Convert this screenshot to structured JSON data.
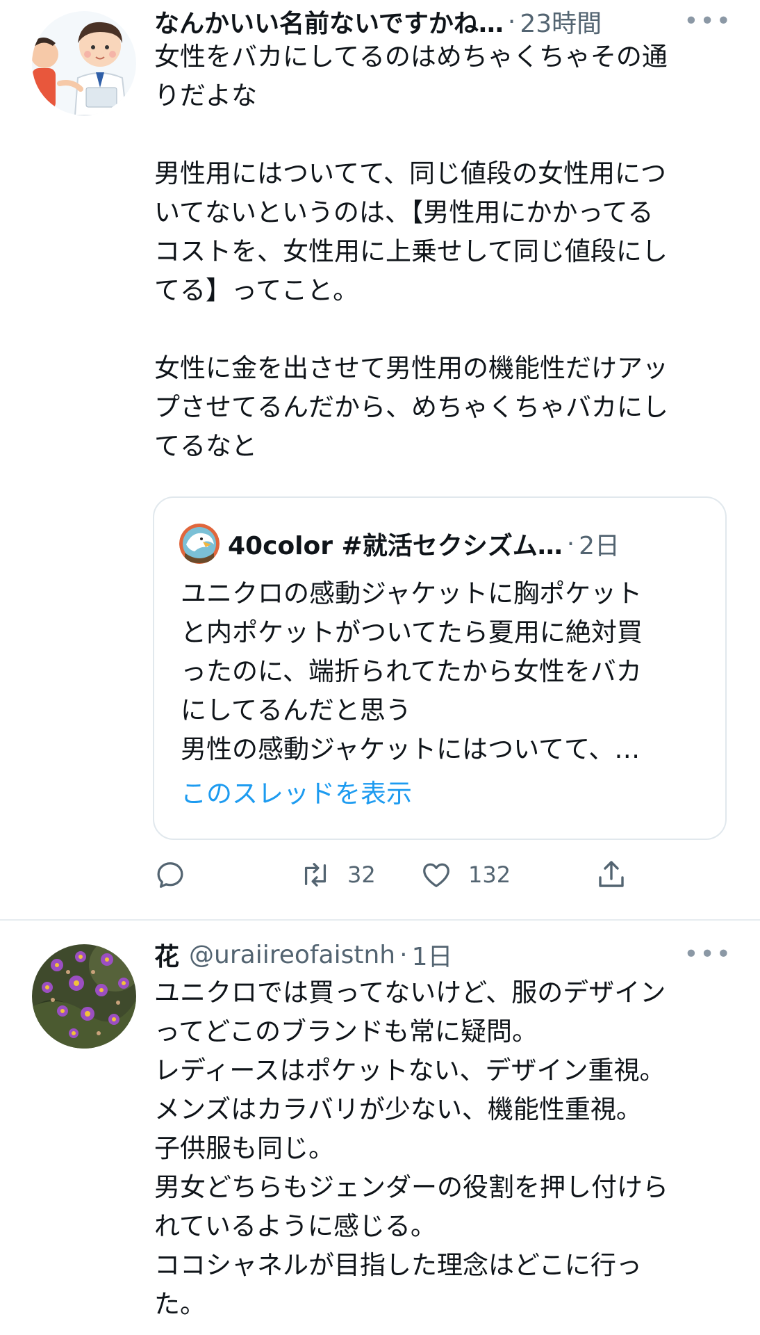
{
  "tweet1": {
    "name": "なんかいい名前ないですかね…",
    "separator": "·",
    "time": "23時間",
    "more": "•••",
    "body": "女性をバカにしてるのはめちゃくちゃその通\nりだよな\n\n男性用にはついてて、同じ値段の女性用につ\nいてないというのは、【男性用にかかってる\nコストを、女性用に上乗せして同じ値段にし\nてる】ってこと。\n\n女性に金を出させて男性用の機能性だけアッ\nプさせてるんだから、めちゃくちゃバカにし\nてるなと",
    "quote": {
      "name": "40color #就活セクシズム…",
      "separator": "·",
      "time": "2日",
      "body": "ユニクロの感動ジャケットに胸ポケット\nと内ポケットがついてたら夏用に絶対買\nったのに、端折られてたから女性をバカ\nにしてるんだと思う\n男性の感動ジャケットにはついてて、…",
      "thread_link": "このスレッドを表示"
    },
    "actions": {
      "reply_icon": "reply-icon",
      "retweet_icon": "retweet-icon",
      "retweet_count": "32",
      "like_icon": "heart-icon",
      "like_count": "132",
      "share_icon": "share-icon"
    }
  },
  "tweet2": {
    "name": "花",
    "handle": "@uraiireofaistnh",
    "separator": "·",
    "time": "1日",
    "more": "•••",
    "body": "ユニクロでは買ってないけど、服のデザイン\nってどこのブランドも常に疑問。\nレディースはポケットない、デザイン重視。\nメンズはカラバリが少ない、機能性重視。\n子供服も同じ。\n男女どちらもジェンダーの役割を押し付けら\nれているように感じる。\nココシャネルが目指した理念はどこに行っ\nた。"
  },
  "colors": {
    "text": "#0f1419",
    "secondary": "#536471",
    "link": "#1d9bf0",
    "border": "#e1e8ed"
  }
}
